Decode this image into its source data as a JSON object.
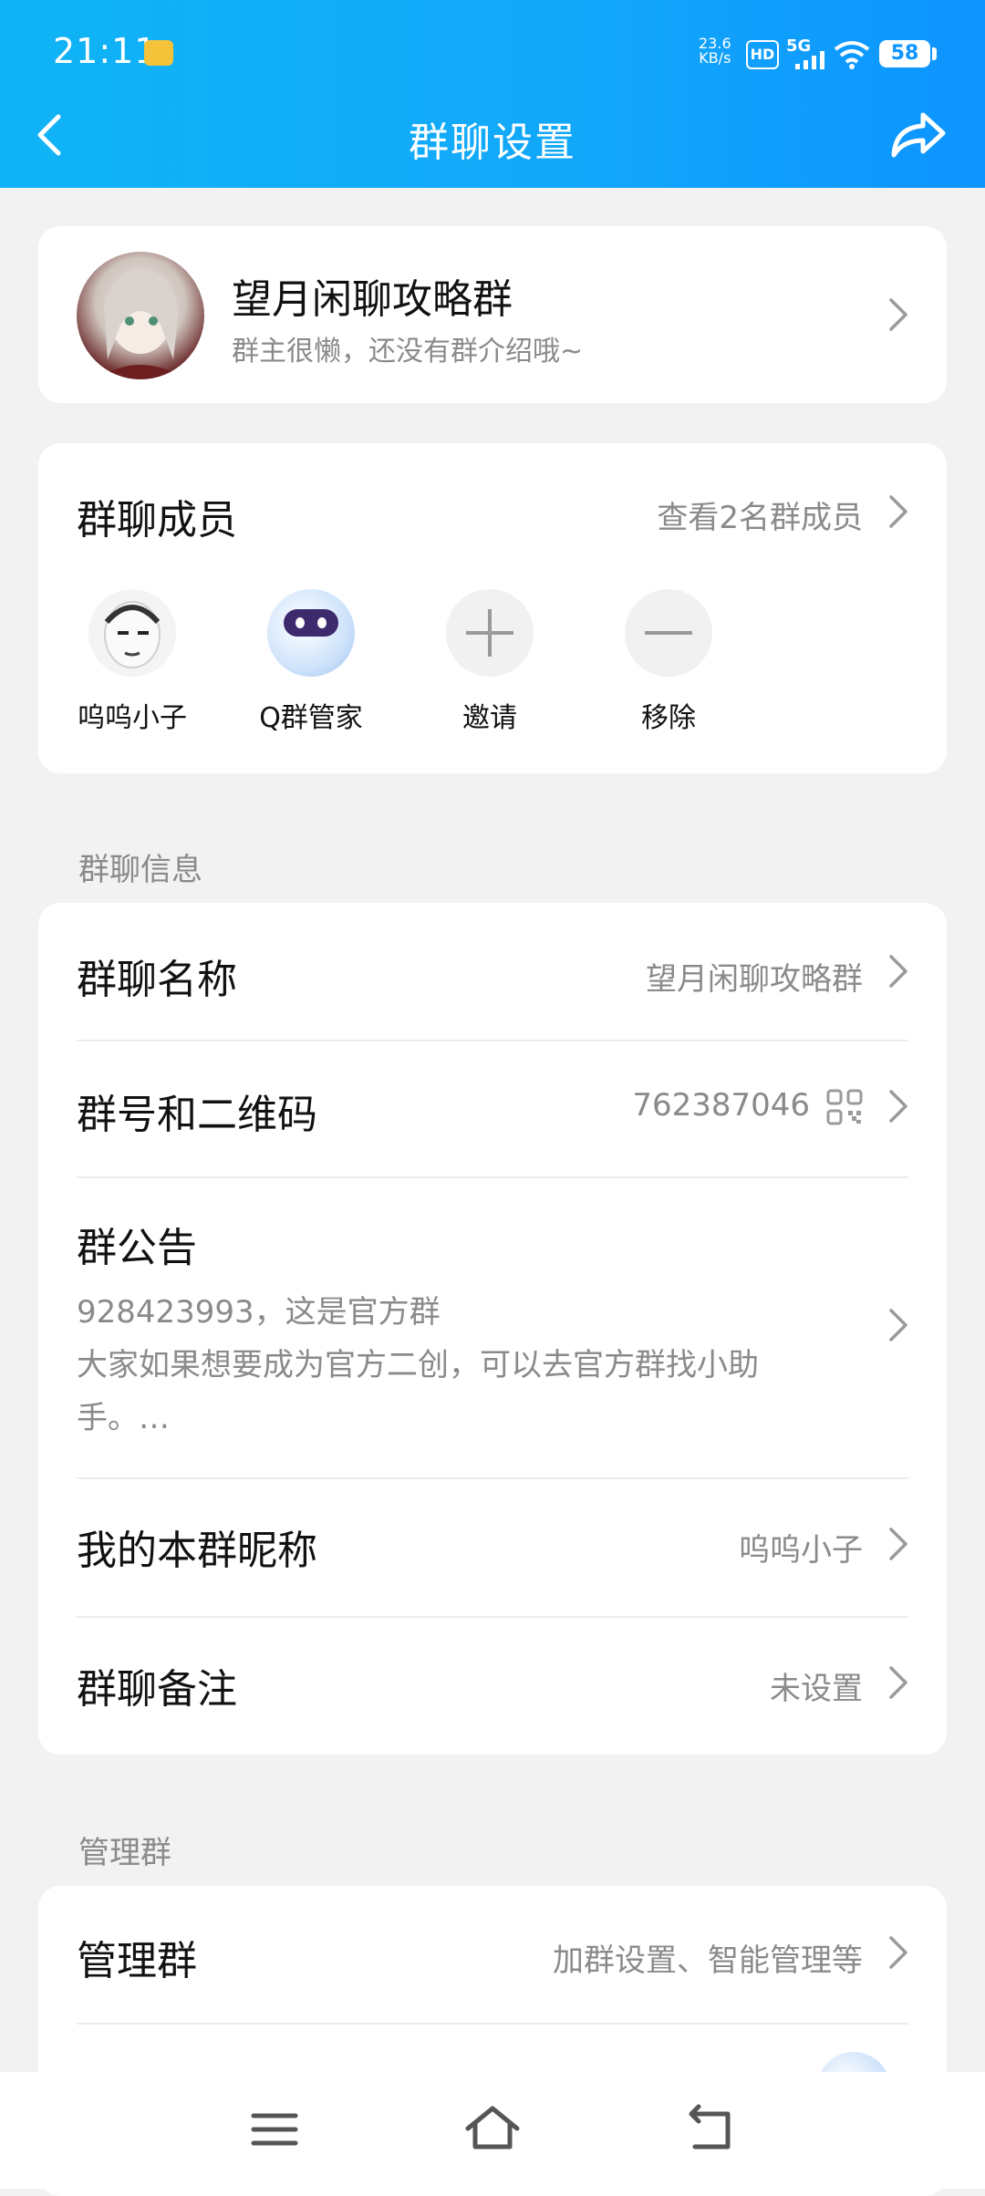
{
  "status_bar": {
    "time": "21:11",
    "net_speed_value": "23.6",
    "net_speed_unit": "KB/s",
    "hd": "HD",
    "signal": "5G",
    "battery": "58"
  },
  "nav": {
    "title": "群聊设置",
    "back_icon": "chevron-left-icon",
    "share_icon": "share-icon"
  },
  "group": {
    "name": "望月闲聊攻略群",
    "description": "群主很懒，还没有群介绍哦~"
  },
  "members": {
    "title": "群聊成员",
    "view_all": "查看2名群成员",
    "items": [
      {
        "label": "呜呜小子"
      },
      {
        "label": "Q群管家"
      },
      {
        "label": "邀请"
      },
      {
        "label": "移除"
      }
    ]
  },
  "info_section": {
    "label": "群聊信息",
    "rows": [
      {
        "label": "群聊名称",
        "value": "望月闲聊攻略群"
      },
      {
        "label": "群号和二维码",
        "value": "762387046"
      },
      {
        "label": "群公告",
        "line1": "928423993，这是官方群",
        "line2": "大家如果想要成为官方二创，可以去官方群找小助",
        "line3": "手。…"
      },
      {
        "label": "我的本群昵称",
        "value": "呜呜小子"
      },
      {
        "label": "群聊备注",
        "value": "未设置"
      }
    ]
  },
  "admin_section": {
    "label": "管理群",
    "rows": [
      {
        "label": "管理群",
        "value": "加群设置、智能管理等"
      }
    ]
  },
  "colors": {
    "header_start": "#10b4f6",
    "header_end": "#0d94ff",
    "background": "#f2f2f2",
    "secondary_text": "#8a8a8a"
  }
}
